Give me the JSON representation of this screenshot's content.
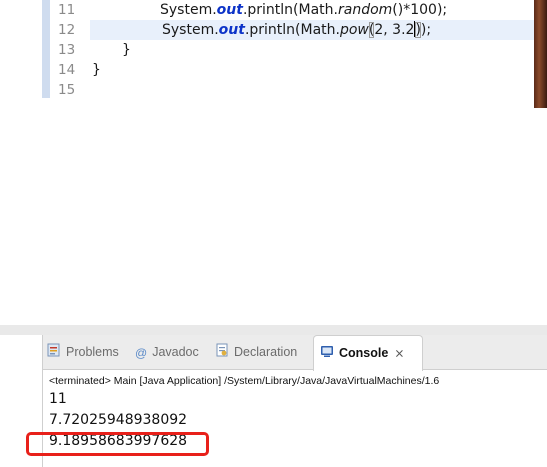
{
  "editor": {
    "lines": [
      {
        "number": "11",
        "code": "System.out.println(Math.random()*100);"
      },
      {
        "number": "12",
        "code": "System.out.println(Math.pow(2, 3.2));"
      },
      {
        "number": "13",
        "code": "}"
      },
      {
        "number": "14",
        "code": "}"
      },
      {
        "number": "15",
        "code": ""
      }
    ],
    "line11": {
      "pre": "System.",
      "field": "out",
      "mid": ".println(Math.",
      "method": "random",
      "post": "()*100);"
    },
    "line12": {
      "pre": "System.",
      "field": "out",
      "mid": ".println(Math.",
      "method": "pow",
      "open": "(",
      "args_a": "2, 3.2",
      "close": ")",
      "post": ");"
    }
  },
  "console_panel": {
    "tabs": [
      {
        "label": "Problems",
        "icon": "problems-icon"
      },
      {
        "label": "Javadoc",
        "icon": "javadoc-icon"
      },
      {
        "label": "Declaration",
        "icon": "declaration-icon"
      },
      {
        "label": "Console",
        "icon": "console-icon",
        "active": true
      }
    ],
    "close_glyph": "⨯",
    "status": "<terminated> Main [Java Application] /System/Library/Java/JavaVirtualMachines/1.6",
    "output": [
      "11",
      "7.72025948938092",
      "9.18958683997628"
    ]
  },
  "colors": {
    "field": "#0d33c8",
    "highlight": "#e8201a",
    "current_line": "#e8f0fb"
  }
}
